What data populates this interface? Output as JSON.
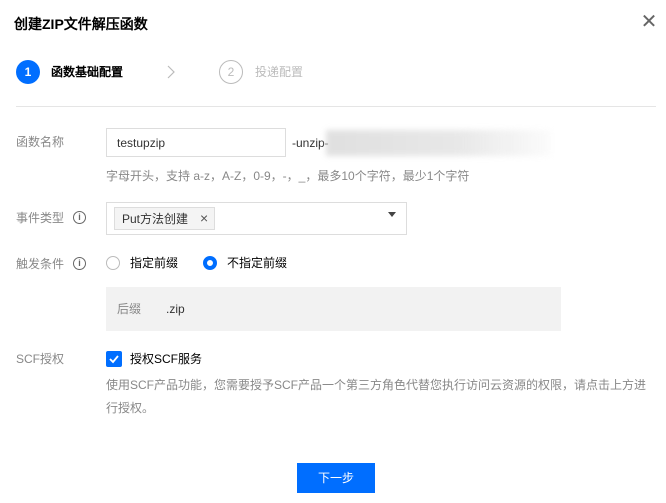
{
  "dialog": {
    "title": "创建ZIP文件解压函数",
    "close_icon": "close-icon"
  },
  "steps": [
    {
      "number": "1",
      "label": "函数基础配置",
      "state": "active"
    },
    {
      "number": "2",
      "label": "投递配置",
      "state": "inactive"
    }
  ],
  "form": {
    "function_name": {
      "label": "函数名称",
      "value": "testupzip",
      "suffix": "-unzip-",
      "hint": "字母开头，支持 a-z，A-Z，0-9，-，_，最多10个字符，最少1个字符"
    },
    "event_type": {
      "label": "事件类型",
      "selected_tag": "Put方法创建"
    },
    "trigger": {
      "label": "触发条件",
      "options": [
        "指定前缀",
        "不指定前缀"
      ],
      "selected": "不指定前缀",
      "suffix_label": "后缀",
      "suffix_value": ".zip"
    },
    "scf": {
      "label": "SCF授权",
      "checkbox_label": "授权SCF服务",
      "checked": true,
      "description": "使用SCF产品功能，您需要授予SCF产品一个第三方角色代替您执行访问云资源的权限，请点击上方进行授权。"
    }
  },
  "footer": {
    "next_label": "下一步"
  },
  "colors": {
    "primary": "#006eff",
    "muted_text": "#888888",
    "border": "#dddddd"
  }
}
